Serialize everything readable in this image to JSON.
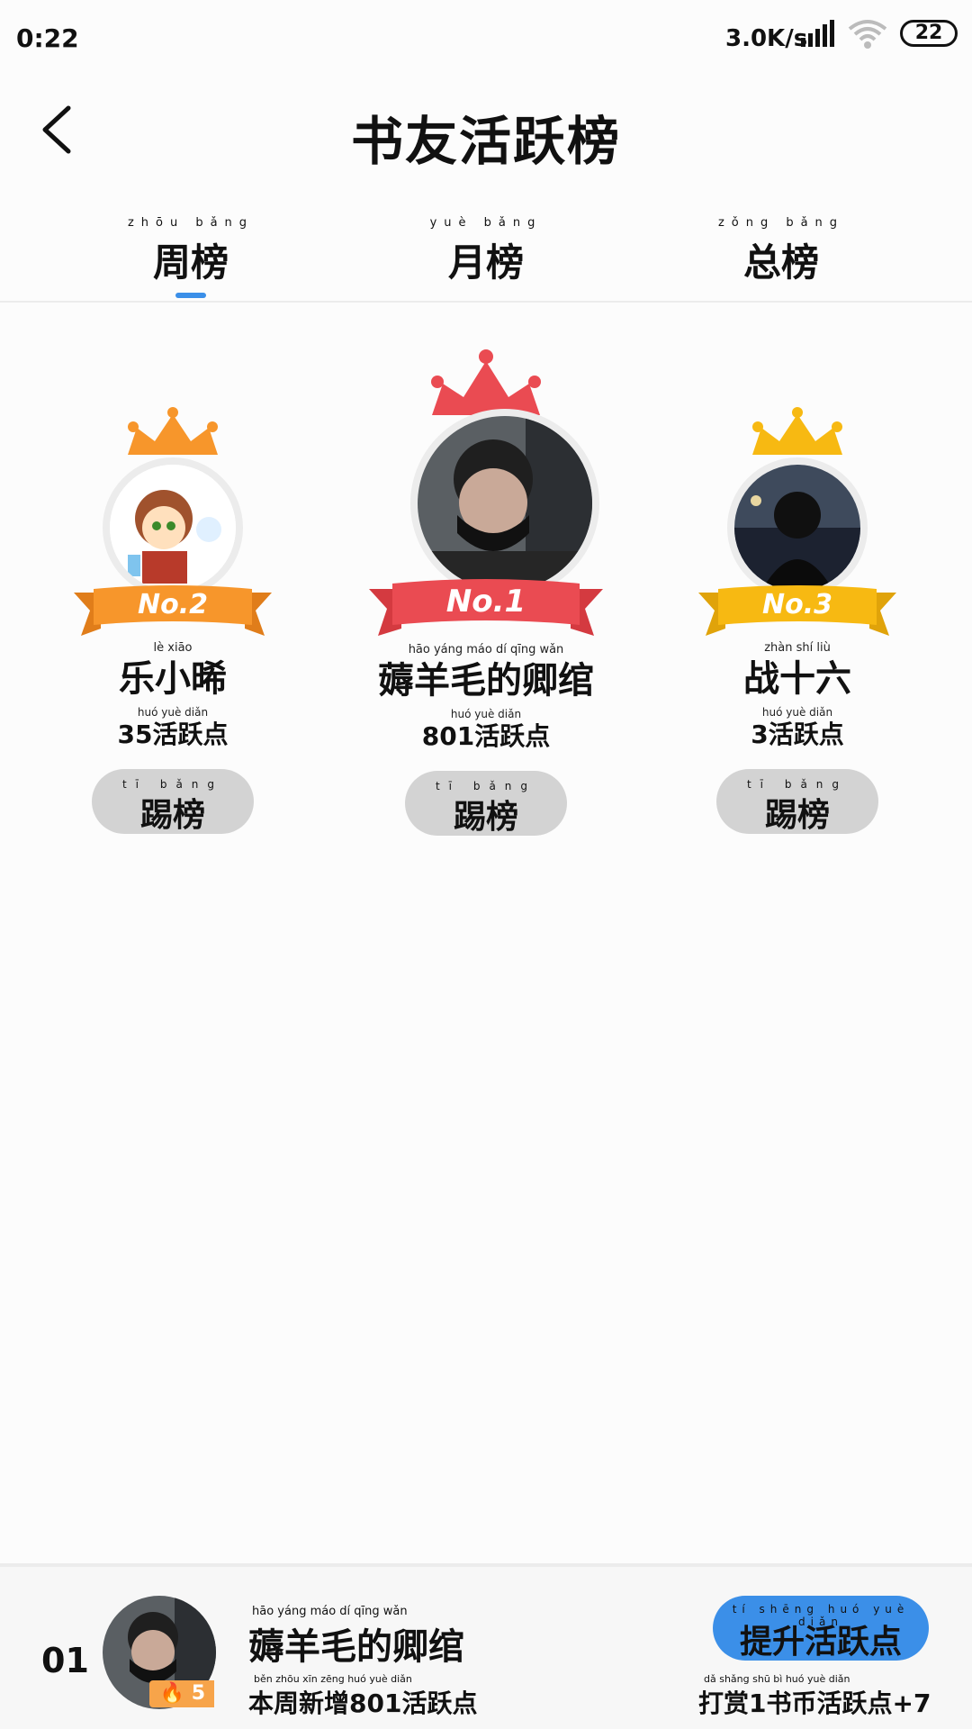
{
  "status_bar": {
    "time": "0:22",
    "speed": "3.0K/s",
    "battery": "22"
  },
  "header": {
    "title": "书友活跃榜"
  },
  "tabs": [
    {
      "pinyin": "zhōu bǎng",
      "label": "周榜",
      "active": true
    },
    {
      "pinyin": "yuè bǎng",
      "label": "月榜",
      "active": false
    },
    {
      "pinyin": "zǒng bǎng",
      "label": "总榜",
      "active": false
    }
  ],
  "podium": [
    {
      "rank_label": "No.2",
      "name_pinyin": "lè  xiāo",
      "name": "乐小晞",
      "points_pinyin": "huó yuè diǎn",
      "points": "35活跃点",
      "kick_pinyin": "tī bǎng",
      "kick_label": "踢榜",
      "crown_color": "#f7962b",
      "ribbon_color": "#f7962b"
    },
    {
      "rank_label": "No.1",
      "name_pinyin": "hāo  yáng  máo  dí  qīng  wǎn",
      "name": "薅羊毛的卿绾",
      "points_pinyin": "huó yuè diǎn",
      "points": "801活跃点",
      "kick_pinyin": "tī bǎng",
      "kick_label": "踢榜",
      "crown_color": "#ea4b52",
      "ribbon_color": "#ea4b52"
    },
    {
      "rank_label": "No.3",
      "name_pinyin": "zhàn  shí  liù",
      "name": "战十六",
      "points_pinyin": "huó yuè diǎn",
      "points": "3活跃点",
      "kick_pinyin": "tī bǎng",
      "kick_label": "踢榜",
      "crown_color": "#f7b912",
      "ribbon_color": "#f7b912"
    }
  ],
  "me": {
    "rank": "01",
    "badge": "5",
    "name_pinyin": "hāo  yáng  máo  dí  qīng  wǎn",
    "name": "薅羊毛的卿绾",
    "stat_pinyin": "běn zhōu xīn zēng     huó yuè diǎn",
    "stat": "本周新增801活跃点",
    "boost_pinyin": "tí shēng huó yuè diǎn",
    "boost_label": "提升活跃点",
    "note_pinyin": "dǎ shǎng  shū bì huó yuè diǎn",
    "note": "打赏1书币活跃点+7"
  }
}
